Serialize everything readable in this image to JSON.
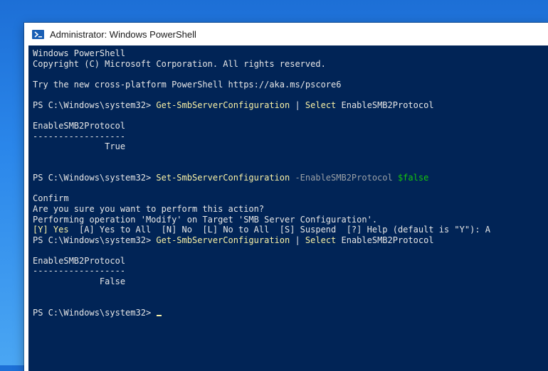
{
  "window": {
    "title": "Administrator: Windows PowerShell"
  },
  "console": {
    "lines": [
      [
        {
          "t": "Windows PowerShell",
          "c": ""
        }
      ],
      [
        {
          "t": "Copyright (C) Microsoft Corporation. All rights reserved.",
          "c": ""
        }
      ],
      [],
      [
        {
          "t": "Try the new cross-platform PowerShell https://aka.ms/pscore6",
          "c": ""
        }
      ],
      [],
      [
        {
          "t": "PS C:\\Windows\\system32> ",
          "c": ""
        },
        {
          "t": "Get-SmbServerConfiguration",
          "c": "yellow"
        },
        {
          "t": " | ",
          "c": ""
        },
        {
          "t": "Select",
          "c": "yellow"
        },
        {
          "t": " EnableSMB2Protocol",
          "c": ""
        }
      ],
      [],
      [
        {
          "t": "EnableSMB2Protocol",
          "c": ""
        }
      ],
      [
        {
          "t": "------------------",
          "c": ""
        }
      ],
      [
        {
          "t": "              True",
          "c": ""
        }
      ],
      [],
      [],
      [
        {
          "t": "PS C:\\Windows\\system32> ",
          "c": ""
        },
        {
          "t": "Set-SmbServerConfiguration",
          "c": "yellow"
        },
        {
          "t": " -EnableSMB2Protocol",
          "c": "gray"
        },
        {
          "t": " $false",
          "c": "green"
        }
      ],
      [],
      [
        {
          "t": "Confirm",
          "c": ""
        }
      ],
      [
        {
          "t": "Are you sure you want to perform this action?",
          "c": ""
        }
      ],
      [
        {
          "t": "Performing operation 'Modify' on Target 'SMB Server Configuration'.",
          "c": ""
        }
      ],
      [
        {
          "t": "[Y] Yes",
          "c": "yellow"
        },
        {
          "t": "  [A] Yes to All  [N] No  [L] No to All  [S] Suspend  [?] Help (default is \"Y\"): A",
          "c": ""
        }
      ],
      [
        {
          "t": "PS C:\\Windows\\system32> ",
          "c": ""
        },
        {
          "t": "Get-SmbServerConfiguration",
          "c": "yellow"
        },
        {
          "t": " | ",
          "c": ""
        },
        {
          "t": "Select",
          "c": "yellow"
        },
        {
          "t": " EnableSMB2Protocol",
          "c": ""
        }
      ],
      [],
      [
        {
          "t": "EnableSMB2Protocol",
          "c": ""
        }
      ],
      [
        {
          "t": "------------------",
          "c": ""
        }
      ],
      [
        {
          "t": "             False",
          "c": ""
        }
      ],
      [],
      [],
      [
        {
          "t": "PS C:\\Windows\\system32> ",
          "c": ""
        }
      ]
    ]
  }
}
